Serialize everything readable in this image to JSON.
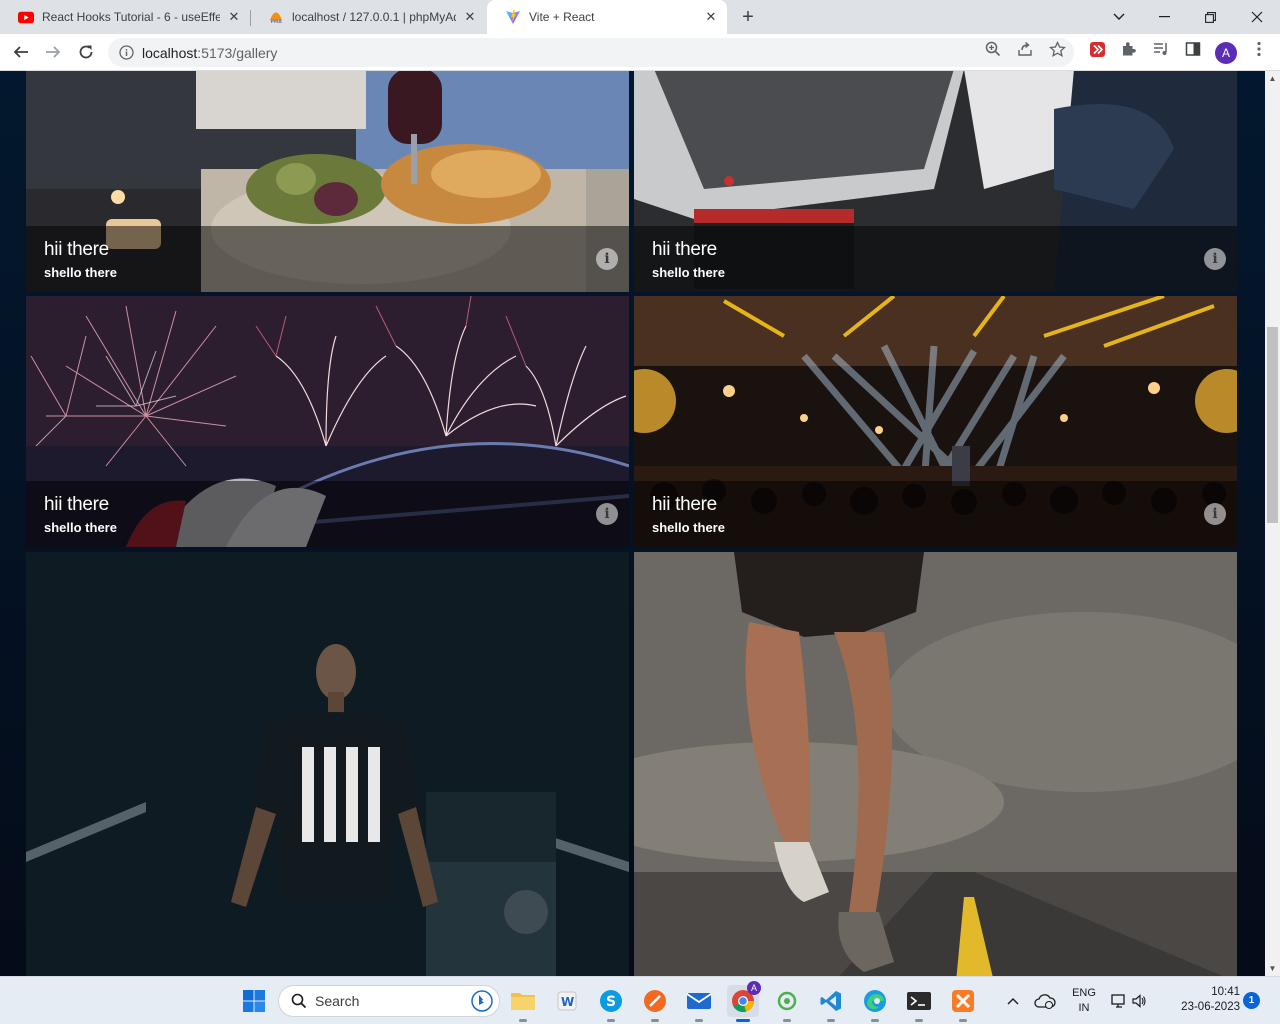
{
  "browser": {
    "tabs": [
      {
        "title": "React Hooks Tutorial - 6 - useEffe",
        "favicon": "youtube-icon",
        "active": false
      },
      {
        "title": "localhost / 127.0.0.1 | phpMyAdm",
        "favicon": "phpmyadmin-icon",
        "active": false
      },
      {
        "title": "Vite + React",
        "favicon": "vite-icon",
        "active": true
      }
    ],
    "url_host": "localhost",
    "url_path": ":5173/gallery",
    "profile_initial": "A"
  },
  "gallery": {
    "tiles": [
      {
        "title": "hii there",
        "subtitle": "shello there",
        "image": "dinner-table-photo",
        "info_glyph": "i"
      },
      {
        "title": "hii there",
        "subtitle": "shello there",
        "image": "laptop-desk-photo",
        "info_glyph": "i"
      },
      {
        "title": "hii there",
        "subtitle": "shello there",
        "image": "fireworks-bridge-photo",
        "info_glyph": "i"
      },
      {
        "title": "hii there",
        "subtitle": "shello there",
        "image": "concert-stage-photo",
        "info_glyph": "i"
      },
      {
        "title": "",
        "subtitle": "",
        "image": "man-in-dark-photo"
      },
      {
        "title": "",
        "subtitle": "",
        "image": "runner-on-road-photo"
      }
    ]
  },
  "taskbar": {
    "search_label": "Search",
    "lang_line1": "ENG",
    "lang_line2": "IN",
    "time": "10:41",
    "date": "23-06-2023",
    "notification_count": "1",
    "chrome_badge": "A"
  }
}
